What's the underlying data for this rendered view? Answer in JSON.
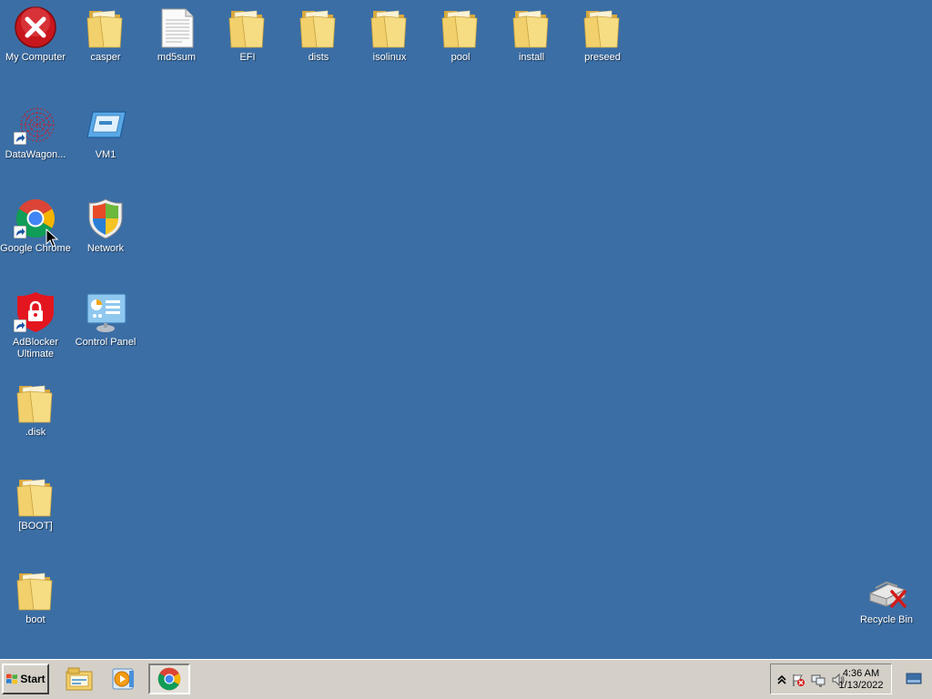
{
  "desktop": {
    "icons": {
      "my_computer": "My Computer",
      "casper": "casper",
      "md5sum": "md5sum",
      "efi": "EFI",
      "dists": "dists",
      "isolinux": "isolinux",
      "pool": "pool",
      "install": "install",
      "preseed": "preseed",
      "datawagon": "DataWagon...",
      "vm1": "VM1",
      "google_chrome": "Google Chrome",
      "network": "Network",
      "adblocker": "AdBlocker Ultimate",
      "control_panel": "Control Panel",
      "disk": ".disk",
      "boot_bracket": "[BOOT]",
      "boot": "boot",
      "recycle_bin": "Recycle Bin"
    }
  },
  "taskbar": {
    "start_label": "Start",
    "pinned": [
      "file-explorer-icon",
      "media-player-icon",
      "chrome-icon"
    ],
    "clock_time": "4:36 AM",
    "clock_date": "1/13/2022"
  },
  "colors": {
    "desktop_bg": "#3b6ea5",
    "taskbar_bg": "#d4d0c8",
    "folder": "#f2d06b"
  }
}
